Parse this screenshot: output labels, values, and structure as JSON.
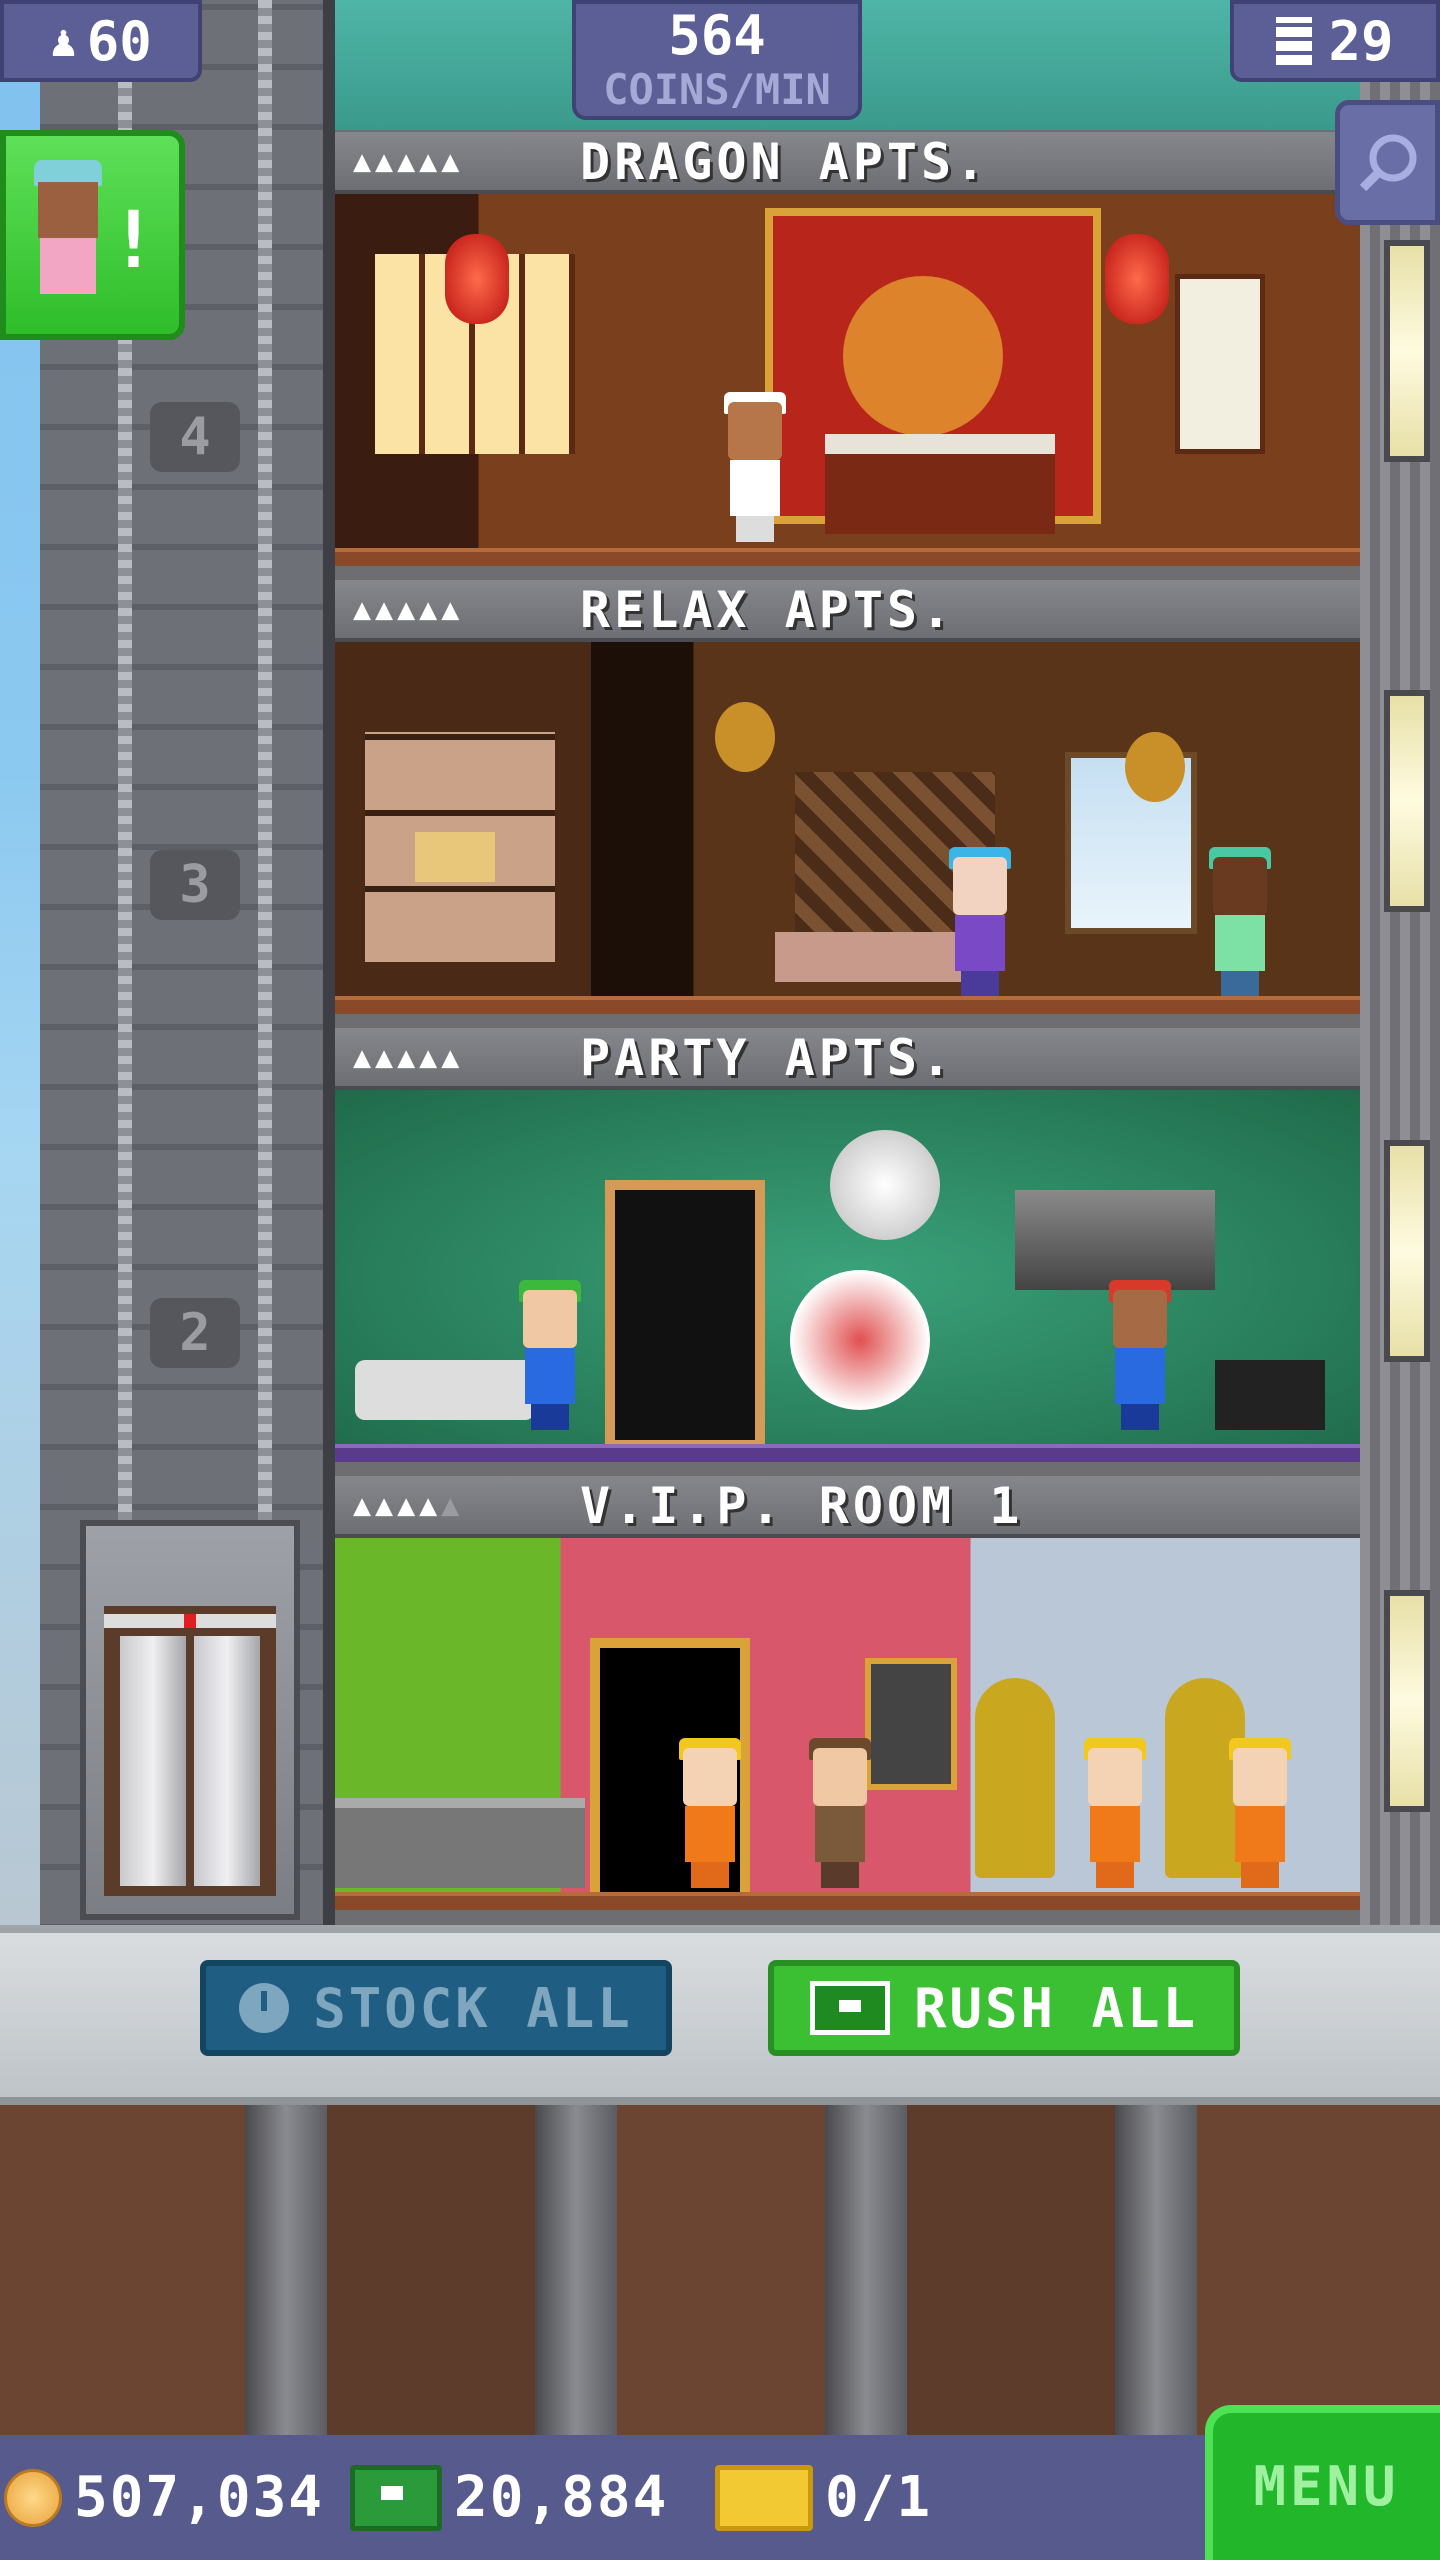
{
  "header": {
    "population": "60",
    "coins_per_min_value": "564",
    "coins_per_min_label": "COINS/MIN",
    "floor_count": "29"
  },
  "elevator_shaft": {
    "floor_numbers": [
      "4",
      "3",
      "2"
    ]
  },
  "floors": [
    {
      "name": "DRAGON APTS.",
      "stars_filled": 5,
      "stars_total": 5,
      "pips": "▲▲▲▲▲",
      "pips_dim": ""
    },
    {
      "name": "RELAX APTS.",
      "stars_filled": 5,
      "stars_total": 5,
      "pips": "▲▲▲▲▲",
      "pips_dim": ""
    },
    {
      "name": "PARTY APTS.",
      "stars_filled": 5,
      "stars_total": 5,
      "pips": "▲▲▲▲▲",
      "pips_dim": ""
    },
    {
      "name": "V.I.P. ROOM 1",
      "stars_filled": 4,
      "stars_total": 5,
      "pips": "▲▲▲▲",
      "pips_dim": "▲"
    }
  ],
  "actions": {
    "stock_all_label": "STOCK ALL",
    "rush_all_label": "RUSH ALL"
  },
  "status": {
    "coins": "507,034",
    "bux": "20,884",
    "tickets": "0/1"
  },
  "menu_label": "MENU",
  "icons": {
    "population": "person-icon",
    "floors": "building-icon",
    "search": "magnifier-icon",
    "stock": "clock-icon",
    "rush": "bux-icon",
    "coins": "coin-icon",
    "tickets": "ticket-icon"
  },
  "colors": {
    "accent_green": "#3bbf33",
    "stock_blue": "#1f5d82",
    "status_bar": "#565a8c"
  }
}
